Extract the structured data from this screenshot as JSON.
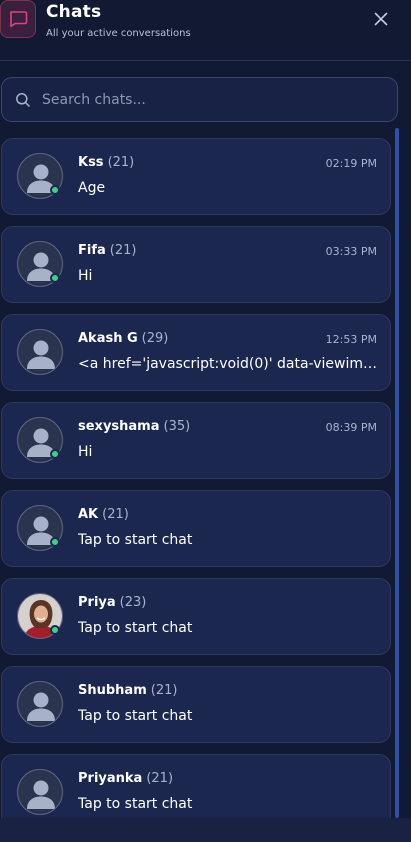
{
  "header": {
    "title": "Chats",
    "subtitle": "All your active conversations",
    "icon": "chat-bubble-icon",
    "accent": "#e0427a"
  },
  "search": {
    "placeholder": "Search chats...",
    "value": ""
  },
  "chats": [
    {
      "name": "Kss",
      "age": "(21)",
      "time": "02:19 PM",
      "message": "Age",
      "online": true,
      "avatar": "default"
    },
    {
      "name": "Fifa",
      "age": "(21)",
      "time": "03:33 PM",
      "message": "Hi",
      "online": true,
      "avatar": "default"
    },
    {
      "name": "Akash G",
      "age": "(29)",
      "time": "12:53 PM",
      "message": "<a href='javascript:void(0)' data-viewimage=",
      "online": false,
      "avatar": "default"
    },
    {
      "name": "sexyshama",
      "age": "(35)",
      "time": "08:39 PM",
      "message": "Hi",
      "online": true,
      "avatar": "default"
    },
    {
      "name": "AK",
      "age": "(21)",
      "time": "",
      "message": "Tap to start chat",
      "online": true,
      "avatar": "default"
    },
    {
      "name": "Priya",
      "age": "(23)",
      "time": "",
      "message": "Tap to start chat",
      "online": true,
      "avatar": "photo"
    },
    {
      "name": "Shubham",
      "age": "(21)",
      "time": "",
      "message": "Tap to start chat",
      "online": false,
      "avatar": "default"
    },
    {
      "name": "Priyanka",
      "age": "(21)",
      "time": "",
      "message": "Tap to start chat",
      "online": false,
      "avatar": "default"
    }
  ],
  "colors": {
    "background": "#121a33",
    "card": "#1c2750",
    "online": "#3ed08a",
    "scrollbar": "#2f4fa8"
  }
}
